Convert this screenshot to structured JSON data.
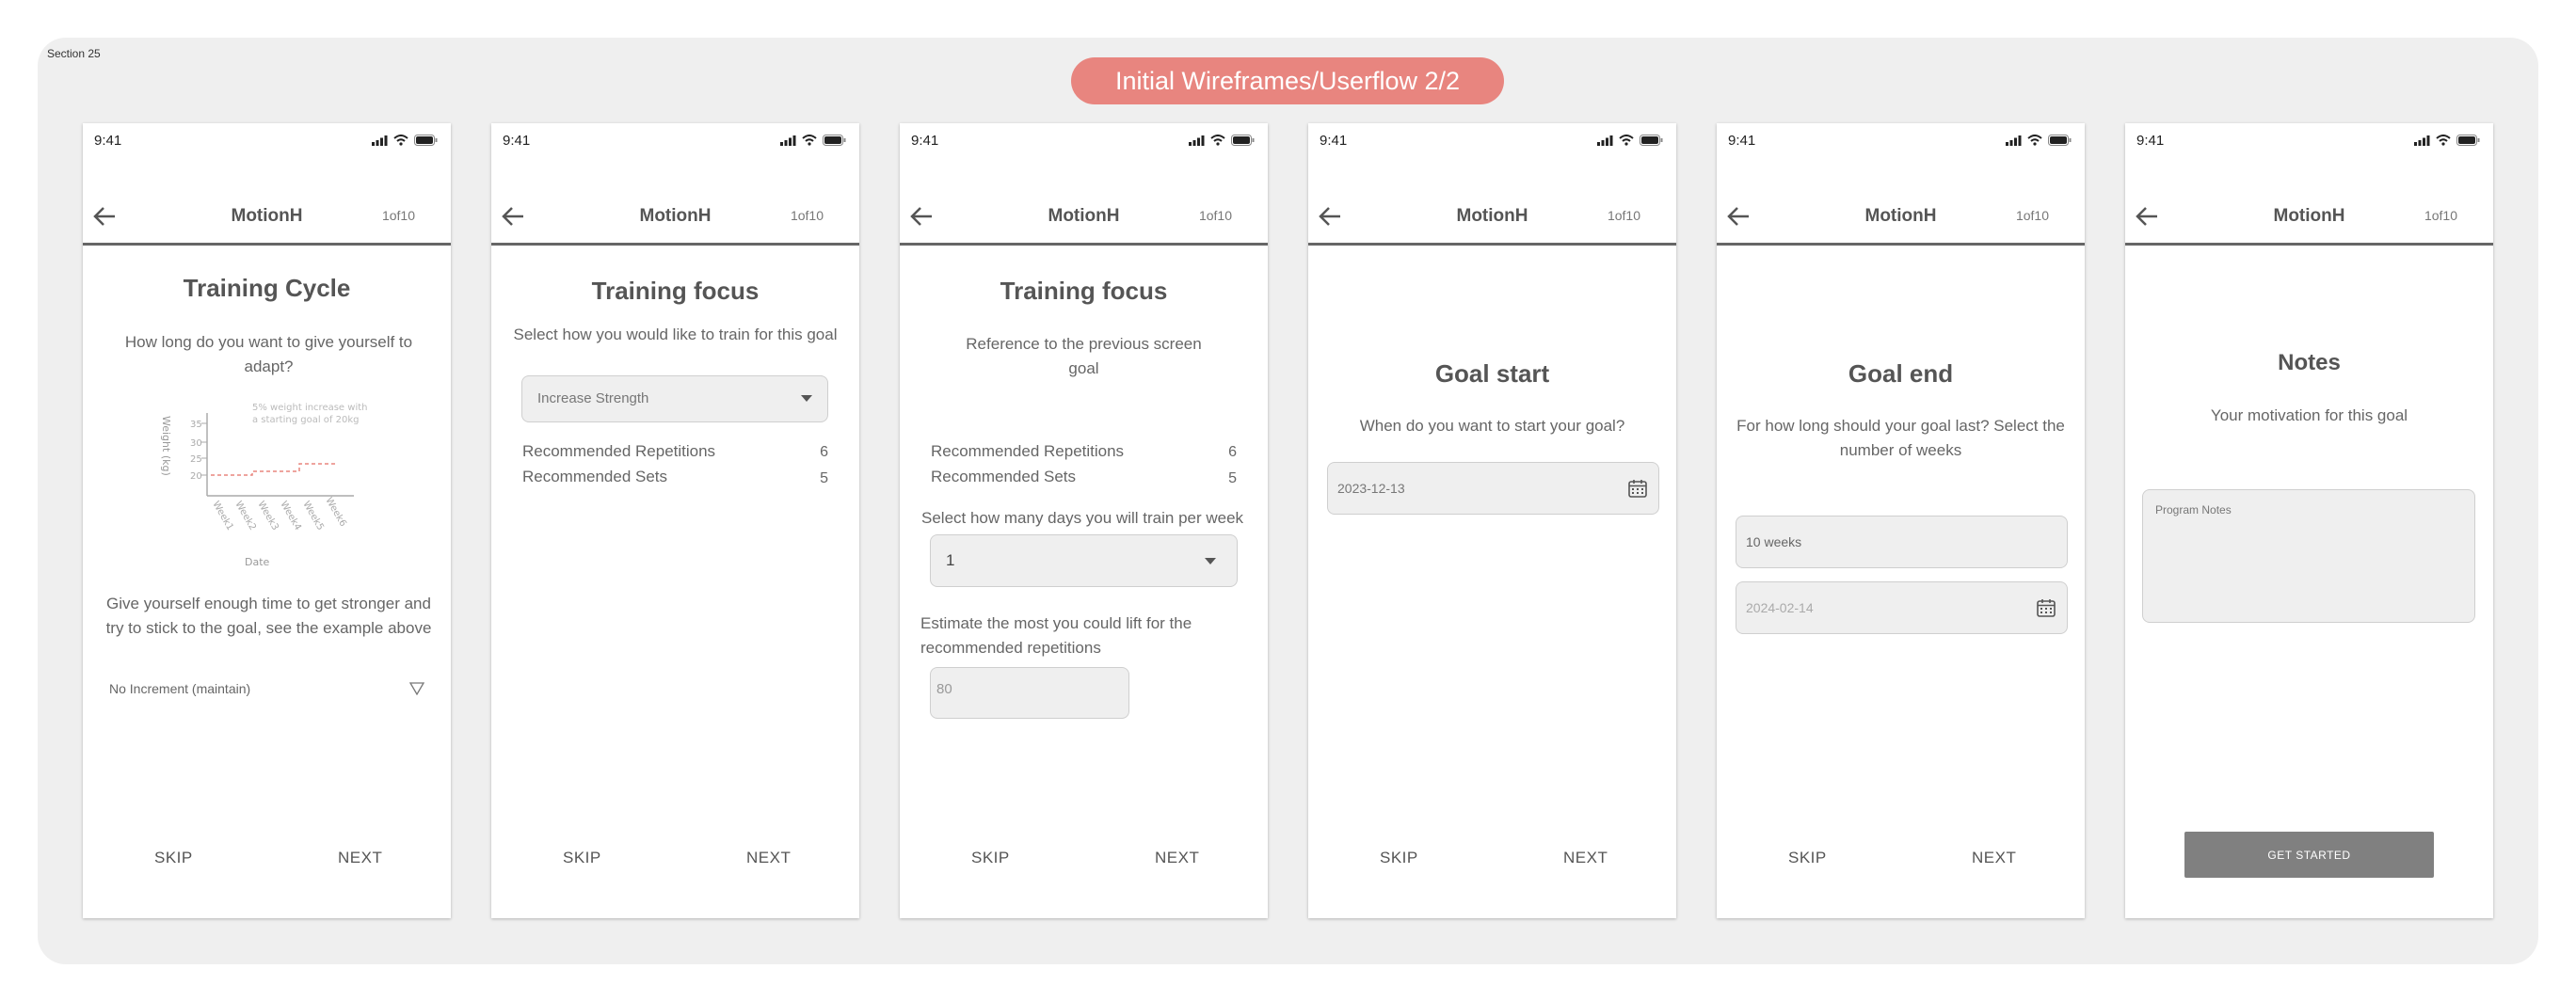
{
  "canvas": {
    "section_label": "Section 25",
    "banner": "Initial Wireframes/Userflow 2/2"
  },
  "common": {
    "time": "9:41",
    "app_title": "MotionH",
    "step": "1of10",
    "skip": "SKIP",
    "next": "NEXT"
  },
  "colors": {
    "banner": "#e8857f",
    "canvas": "#efefef",
    "button": "#808080",
    "chart_line": "#e8857f"
  },
  "screens": [
    {
      "title": "Training Cycle",
      "question": "How long do you want to give yourself to adapt?",
      "hint": "Give yourself enough time to get stronger and try to stick to the goal, see the example above",
      "select_value": "No Increment (maintain)",
      "chart": {
        "annotation_line1": "5% weight increase with",
        "annotation_line2": "a starting goal of 20kg",
        "ylabel": "Weight (kg)",
        "xlabel": "Date",
        "yticks": [
          "35",
          "30",
          "25",
          "20"
        ],
        "xticks": [
          "Week1",
          "Week2",
          "Week3",
          "Week4",
          "Week5",
          "Week6"
        ]
      }
    },
    {
      "title": "Training focus",
      "question": "Select how you would like to train for this goal",
      "select_value": "Increase Strength",
      "rep_label": "Recommended Repetitions",
      "rep_value": "6",
      "sets_label": "Recommended Sets",
      "sets_value": "5"
    },
    {
      "title": "Training focus",
      "reference": "Reference to the previous screen goal",
      "rep_label": "Recommended Repetitions",
      "rep_value": "6",
      "sets_label": "Recommended Sets",
      "sets_value": "5",
      "days_question": "Select how many days you will train per week",
      "days_value": "1",
      "lift_question": "Estimate the most you could lift for the recommended repetitions",
      "lift_value": "80"
    },
    {
      "title": "Goal start",
      "question": "When do you want to start your goal?",
      "date_value": "2023-12-13"
    },
    {
      "title": "Goal end",
      "question": "For how long should your goal last? Select the number of weeks",
      "weeks_value": "10 weeks",
      "date_value": "2024-02-14"
    },
    {
      "title": "Notes",
      "subtitle": "Your motivation for this goal",
      "notes_placeholder": "Program Notes",
      "cta": "GET STARTED"
    }
  ]
}
